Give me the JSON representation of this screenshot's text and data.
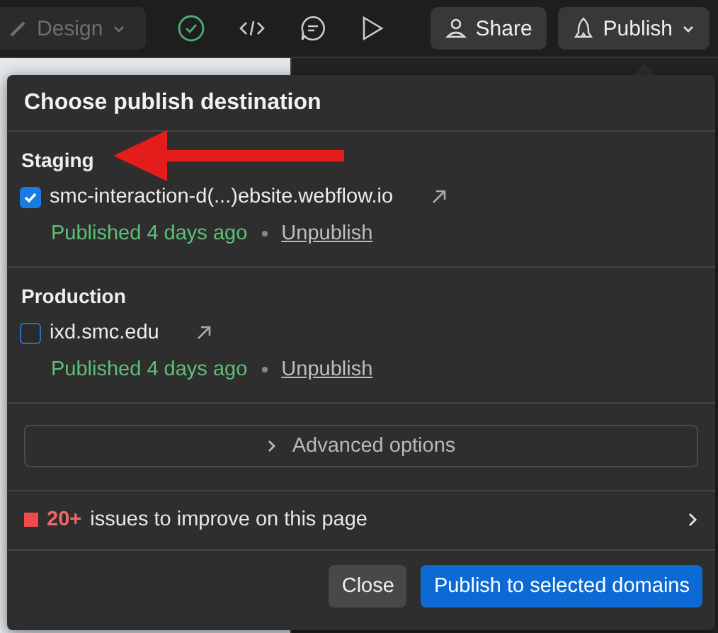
{
  "toolbar": {
    "mode_button": {
      "label": "Design",
      "disabled": true
    },
    "share_button": {
      "label": "Share"
    },
    "publish_button": {
      "label": "Publish"
    }
  },
  "dialog": {
    "title": "Choose publish destination",
    "sections": [
      {
        "heading": "Staging",
        "domain": "smc-interaction-d(...)ebsite.webflow.io",
        "checked": true,
        "status": "Published 4 days ago",
        "action": "Unpublish"
      },
      {
        "heading": "Production",
        "domain": "ixd.smc.edu",
        "checked": false,
        "status": "Published 4 days ago",
        "action": "Unpublish"
      }
    ],
    "advanced": {
      "label": "Advanced options"
    },
    "issues": {
      "count": "20+",
      "text": "issues to improve on this page"
    },
    "buttons": [
      {
        "label": "Close",
        "kind": "secondary"
      },
      {
        "label": "Publish to selected domains",
        "kind": "primary"
      }
    ]
  }
}
